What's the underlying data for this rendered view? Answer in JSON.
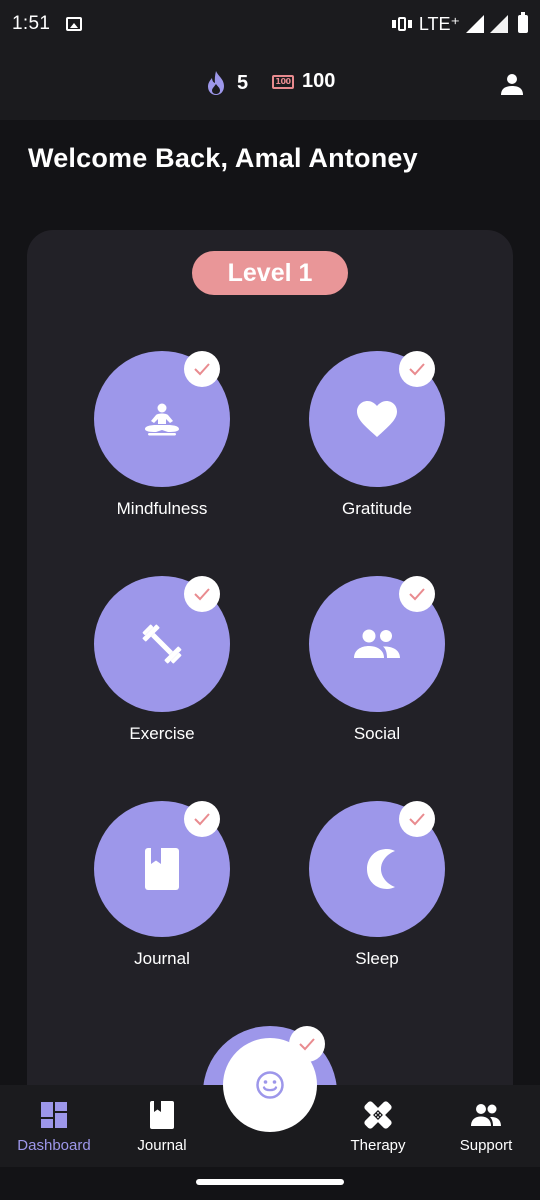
{
  "status_bar": {
    "time": "1:51",
    "network": "LTE⁺"
  },
  "header": {
    "streak_count": "5",
    "points": "100",
    "hundred_icon_text": "100"
  },
  "welcome": "Welcome Back, Amal Antoney",
  "level": "Level 1",
  "activities": [
    {
      "label": "Mindfulness",
      "icon": "meditation-icon",
      "completed": true
    },
    {
      "label": "Gratitude",
      "icon": "heart-icon",
      "completed": true
    },
    {
      "label": "Exercise",
      "icon": "dumbbell-icon",
      "completed": true
    },
    {
      "label": "Social",
      "icon": "people-icon",
      "completed": true
    },
    {
      "label": "Journal",
      "icon": "book-icon",
      "completed": true
    },
    {
      "label": "Sleep",
      "icon": "moon-icon",
      "completed": true
    }
  ],
  "mood_activity": {
    "icon": "smiley-icon",
    "completed": true
  },
  "bottom_nav": [
    {
      "label": "Dashboard",
      "icon": "dashboard-icon",
      "active": true
    },
    {
      "label": "Journal",
      "icon": "book-icon",
      "active": false
    },
    {
      "label": "Therapy",
      "icon": "bandage-icon",
      "active": false
    },
    {
      "label": "Support",
      "icon": "people-icon",
      "active": false
    }
  ],
  "colors": {
    "accent": "#9d97ea",
    "level_pill": "#e99698",
    "check": "#e98b8f",
    "background": "#131316",
    "card": "#222127",
    "bar": "#1b1b1e"
  }
}
